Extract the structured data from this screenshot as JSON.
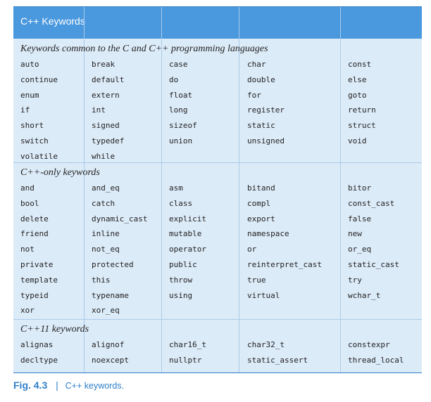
{
  "table": {
    "title": "C++ Keywords",
    "sections": [
      {
        "title": "Keywords common to the C and C++ programming languages",
        "rows": [
          [
            "auto",
            "break",
            "case",
            "char",
            "const"
          ],
          [
            "continue",
            "default",
            "do",
            "double",
            "else"
          ],
          [
            "enum",
            "extern",
            "float",
            "for",
            "goto"
          ],
          [
            "if",
            "int",
            "long",
            "register",
            "return"
          ],
          [
            "short",
            "signed",
            "sizeof",
            "static",
            "struct"
          ],
          [
            "switch",
            "typedef",
            "union",
            "unsigned",
            "void"
          ],
          [
            "volatile",
            "while",
            "",
            "",
            ""
          ]
        ]
      },
      {
        "title": "C++-only keywords",
        "rows": [
          [
            "and",
            "and_eq",
            "asm",
            "bitand",
            "bitor"
          ],
          [
            "bool",
            "catch",
            "class",
            "compl",
            "const_cast"
          ],
          [
            "delete",
            "dynamic_cast",
            "explicit",
            "export",
            "false"
          ],
          [
            "friend",
            "inline",
            "mutable",
            "namespace",
            "new"
          ],
          [
            "not",
            "not_eq",
            "operator",
            "or",
            "or_eq"
          ],
          [
            "private",
            "protected",
            "public",
            "reinterpret_cast",
            "static_cast"
          ],
          [
            "template",
            "this",
            "throw",
            "true",
            "try"
          ],
          [
            "typeid",
            "typename",
            "using",
            "virtual",
            "wchar_t"
          ],
          [
            "xor",
            "xor_eq",
            "",
            "",
            ""
          ]
        ]
      },
      {
        "title": "C++11 keywords",
        "rows": [
          [
            "alignas",
            "alignof",
            "char16_t",
            "char32_t",
            "constexpr"
          ],
          [
            "decltype",
            "noexcept",
            "nullptr",
            "static_assert",
            "thread_local"
          ]
        ]
      }
    ]
  },
  "caption": {
    "figure": "Fig. 4.3",
    "separator": "|",
    "text": "C++ keywords."
  }
}
